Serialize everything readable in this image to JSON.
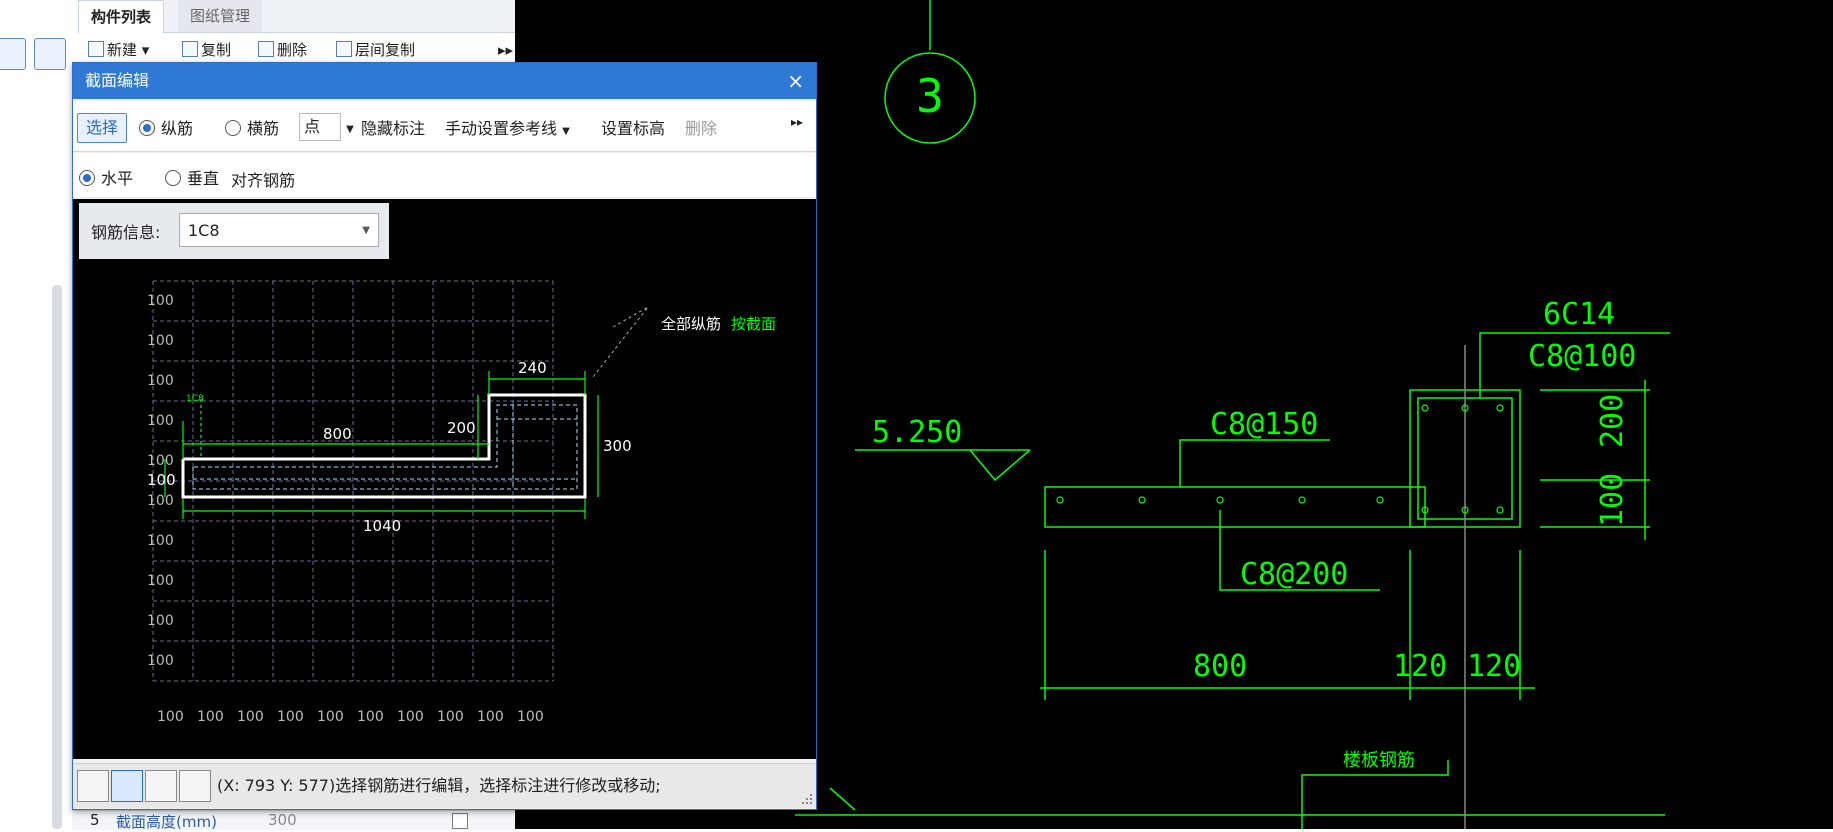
{
  "left_panel": {
    "tabs": [
      {
        "label": "构件列表"
      },
      {
        "label": "图纸管理"
      }
    ],
    "toolbar": [
      {
        "label": "新建",
        "icon": "new-icon"
      },
      {
        "label": "复制",
        "icon": "copy-icon"
      },
      {
        "label": "删除",
        "icon": "delete-icon"
      },
      {
        "label": "层间复制",
        "icon": "layer-copy-icon"
      }
    ],
    "property_row": {
      "index": "5",
      "name": "截面高度(mm)",
      "value": "300"
    }
  },
  "dialog": {
    "title": "截面编辑",
    "close": "×",
    "toolbar1": {
      "select": "选择",
      "longitudinal": "纵筋",
      "transverse": "横筋",
      "point": "点",
      "hide_annot": "隐藏标注",
      "manual_ref": "手动设置参考线",
      "set_elev": "设置标高",
      "delete": "删除",
      "more": "▸▸"
    },
    "toolbar2": {
      "horizontal": "水平",
      "vertical": "垂直",
      "align": "对齐钢筋"
    },
    "rebar_info": {
      "label": "钢筋信息:",
      "value": "1C8"
    },
    "drawing": {
      "grid_label": "100",
      "annot_all": "全部纵筋",
      "annot_section": "按截面",
      "dims": {
        "d240": "240",
        "d800": "800",
        "d200": "200",
        "d300": "300",
        "d100": "100",
        "d1040": "1040"
      },
      "small_label": "1C8"
    },
    "status_text": "(X: 793 Y: 577)选择钢筋进行编辑，选择标注进行修改或移动;"
  },
  "cad": {
    "axis_label": "3",
    "elevation": "5.250",
    "rebar_top1": "6C14",
    "rebar_top2": "C8@100",
    "rebar_mid": "C8@150",
    "rebar_bot": "C8@200",
    "dim_800": "800",
    "dim_120a": "120",
    "dim_120b": "120",
    "dim_200": "200",
    "dim_100": "100",
    "slab_label": "楼板钢筋"
  },
  "colors": {
    "cad_green": "#00ff00",
    "cad_white": "#ffffff",
    "title_blue": "#2f78d4"
  }
}
